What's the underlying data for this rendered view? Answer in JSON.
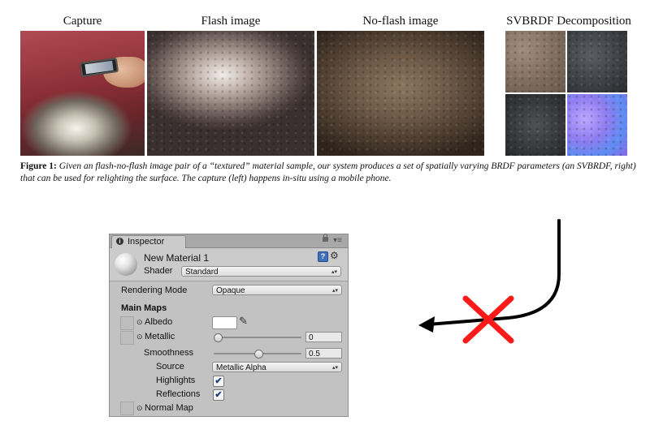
{
  "figure": {
    "labels": {
      "capture": "Capture",
      "flash": "Flash image",
      "no_flash": "No-flash image",
      "svbrdf": "SVBRDF Decomposition"
    },
    "caption": {
      "prefix": "Figure 1:",
      "text": "Given an flash-no-flash image pair of a “textured” material sample, our system produces a set of spatially varying BRDF parameters (an SVBRDF, right) that can be used for relighting the surface. The capture (left) happens in-situ using a mobile phone."
    }
  },
  "inspector": {
    "tab_label": "Inspector",
    "material_name": "New Material 1",
    "shader_label": "Shader",
    "shader_value": "Standard",
    "rendering_mode_label": "Rendering Mode",
    "rendering_mode_value": "Opaque",
    "main_maps_label": "Main Maps",
    "albedo_label": "Albedo",
    "metallic_label": "Metallic",
    "metallic_value": "0",
    "metallic_fraction": 0.0,
    "smoothness_label": "Smoothness",
    "smoothness_value": "0.5",
    "smoothness_fraction": 0.5,
    "source_label": "Source",
    "source_value": "Metallic Alpha",
    "highlights_label": "Highlights",
    "highlights_checked": true,
    "reflections_label": "Reflections",
    "reflections_checked": true,
    "normal_map_label": "Normal Map",
    "check_glyph": "✔",
    "dot_glyph": "⊙",
    "dropdown_arrow": "▴▾"
  },
  "annotation": {
    "arrow_color": "#000000",
    "cross_color": "#ff1a1a",
    "cross_glyph": "✕"
  }
}
